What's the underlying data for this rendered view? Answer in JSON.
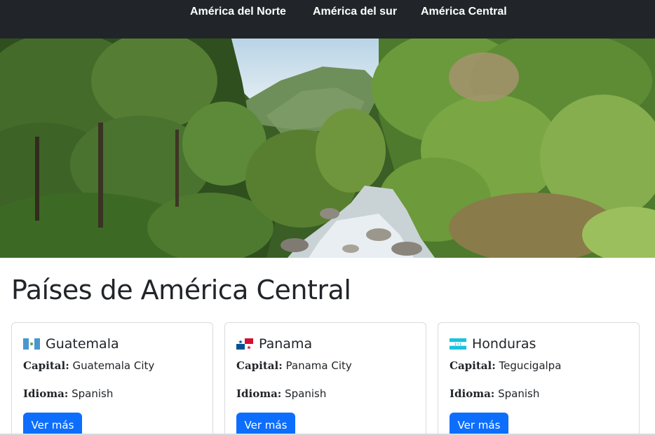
{
  "navbar": {
    "links": [
      {
        "label": "América del Norte"
      },
      {
        "label": "América del sur"
      },
      {
        "label": "América Central"
      }
    ]
  },
  "hero": {
    "image_subject": "tropical forest with river",
    "colors": {
      "sky": "#cfe2ee",
      "forest": "#3f6b2a",
      "water": "#dfe8ee"
    }
  },
  "main": {
    "title": "Países de América Central",
    "cards": [
      {
        "flag_icon": "guatemala-flag",
        "country": "Guatemala",
        "capital_label": "Capital:",
        "capital": "Guatemala City",
        "language_label": "Idioma:",
        "language": "Spanish",
        "button": "Ver más"
      },
      {
        "flag_icon": "panama-flag",
        "country": "Panama",
        "capital_label": "Capital:",
        "capital": "Panama City",
        "language_label": "Idioma:",
        "language": "Spanish",
        "button": "Ver más"
      },
      {
        "flag_icon": "honduras-flag",
        "country": "Honduras",
        "capital_label": "Capital:",
        "capital": "Tegucigalpa",
        "language_label": "Idioma:",
        "language": "Spanish",
        "button": "Ver más"
      }
    ]
  },
  "colors": {
    "navbar": "#212529",
    "primary": "#0d6efd",
    "border": "#d8dbde"
  }
}
